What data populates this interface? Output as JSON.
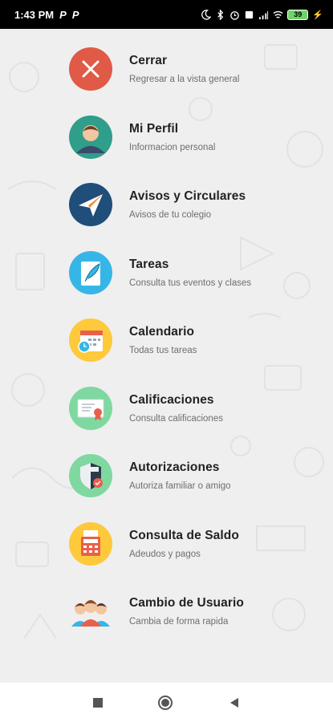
{
  "status_bar": {
    "time": "1:43 PM",
    "notif_1": "P",
    "notif_2": "P",
    "battery": "39"
  },
  "menu": {
    "items": [
      {
        "title": "Cerrar",
        "subtitle": "Regresar a la vista general",
        "icon": "close-icon"
      },
      {
        "title": "Mi Perfil",
        "subtitle": "Informacion personal",
        "icon": "profile-icon"
      },
      {
        "title": "Avisos y Circulares",
        "subtitle": "Avisos de tu colegio",
        "icon": "paper-plane-icon"
      },
      {
        "title": "Tareas",
        "subtitle": "Consulta tus eventos y clases",
        "icon": "feather-note-icon"
      },
      {
        "title": "Calendario",
        "subtitle": "Todas tus tareas",
        "icon": "calendar-icon"
      },
      {
        "title": "Calificaciones",
        "subtitle": "Consulta calificaciones",
        "icon": "certificate-icon"
      },
      {
        "title": "Autorizaciones",
        "subtitle": "Autoriza familiar o amigo",
        "icon": "shield-icon"
      },
      {
        "title": "Consulta de Saldo",
        "subtitle": "Adeudos y pagos",
        "icon": "calculator-icon"
      },
      {
        "title": "Cambio de Usuario",
        "subtitle": "Cambia de forma rapida",
        "icon": "users-icon"
      }
    ]
  },
  "nav_bar": {
    "recents": "square-icon",
    "home": "circle-icon",
    "back": "triangle-back-icon"
  },
  "colors": {
    "close": "#e05a47",
    "profile": "#2f9e8a",
    "avisos": "#1f4e7a",
    "tareas": "#35b6e6",
    "calendario": "#ffc93c",
    "calificaciones": "#7fd8a0",
    "autorizaciones": "#7fd8a0",
    "saldo": "#ffc93c"
  }
}
